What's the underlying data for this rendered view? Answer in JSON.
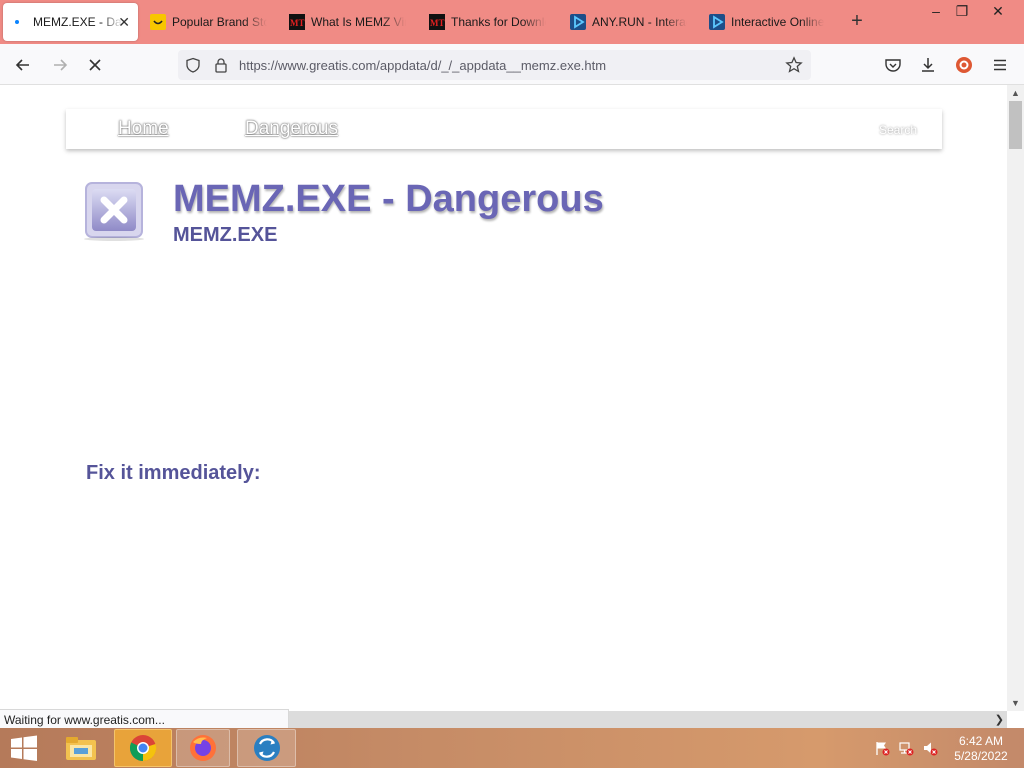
{
  "browser": {
    "tabs": [
      {
        "label": "MEMZ.EXE - Dangerous",
        "active": true,
        "icon": "loading-dot-icon"
      },
      {
        "label": "Popular Brand Stores",
        "active": false,
        "icon": "smiley-favicon-icon"
      },
      {
        "label": "What Is MEMZ Virus",
        "active": false,
        "icon": "mt-favicon-icon"
      },
      {
        "label": "Thanks for Downloading",
        "active": false,
        "icon": "mt-favicon-icon"
      },
      {
        "label": "ANY.RUN - Interactive",
        "active": false,
        "icon": "anyrun-favicon-icon"
      },
      {
        "label": "Interactive Online",
        "active": false,
        "icon": "anyrun-favicon-icon"
      }
    ],
    "new_tab_symbol": "+",
    "url": "https://www.greatis.com/appdata/d/_/_appdata__memz.exe.htm",
    "status": "Waiting for www.greatis.com...",
    "colors": {
      "tabstrip": "#f08b85",
      "navbar": "#f9f9fb"
    }
  },
  "page": {
    "nav": {
      "home": "Home",
      "dangerous": "Dangerous",
      "search": "Search"
    },
    "title": "MEMZ.EXE - Dangerous",
    "subtitle": "MEMZ.EXE",
    "fix_heading": "Fix it immediately:",
    "colors": {
      "title": "#6a66b5",
      "subtitle": "#555499"
    }
  },
  "taskbar": {
    "clock_time": "6:42 AM",
    "clock_date": "5/28/2022",
    "apps": [
      "start-icon",
      "file-explorer-icon",
      "chrome-icon",
      "firefox-icon",
      "anyrun-app-icon"
    ]
  }
}
